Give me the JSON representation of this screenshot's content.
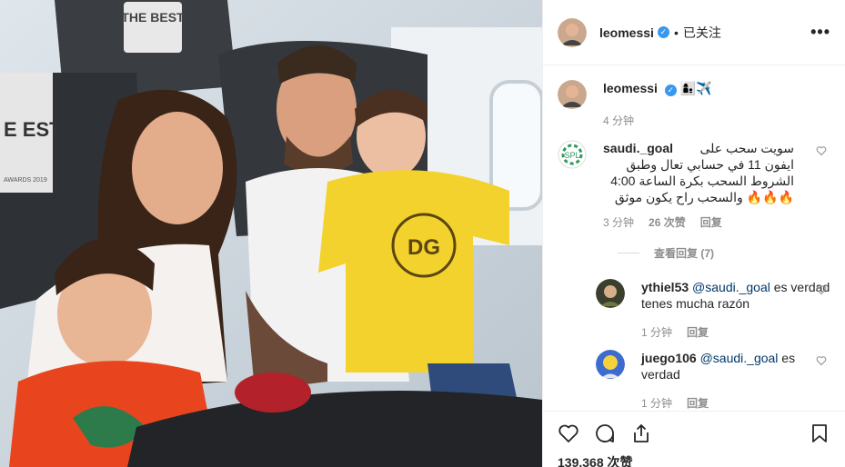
{
  "post": {
    "username": "leomessi",
    "follow_status": "已关注",
    "dot": "•",
    "more_label": "•••"
  },
  "caption": {
    "username": "leomessi",
    "emoji": "👩‍👦✈️",
    "time": "4 分钟"
  },
  "comments": [
    {
      "username": "saudi._goal",
      "text_lines": [
        "سويت سحب على",
        "ايفون 11 في حسابي تعال وطبق",
        "الشروط السحب بكرة الساعة 4:00",
        "والسحب راح يكون موثق"
      ],
      "fire": "🔥🔥🔥",
      "time": "3 分钟",
      "likes": "26 次赞",
      "reply_label": "回复",
      "view_replies": "查看回复 (7)"
    }
  ],
  "replies": [
    {
      "username": "ythiel53",
      "mention": "@saudi._goal",
      "text": " es verdad tenes mucha razón",
      "time": "1 分钟",
      "reply_label": "回复"
    },
    {
      "username": "juego106",
      "mention": "@saudi._goal",
      "text": " es verdad",
      "time": "1 分钟",
      "reply_label": "回复"
    }
  ],
  "footer": {
    "likes": "139,368 次赞"
  },
  "photo": {
    "seat_text_1": "THE BEST",
    "seat_text_2": "E EST",
    "seat_text_3": "AWARDS 2019",
    "shirt_text": "DG"
  },
  "colors": {
    "link": "#00376b",
    "verified": "#3897f0",
    "muted": "#8e8e8e"
  }
}
